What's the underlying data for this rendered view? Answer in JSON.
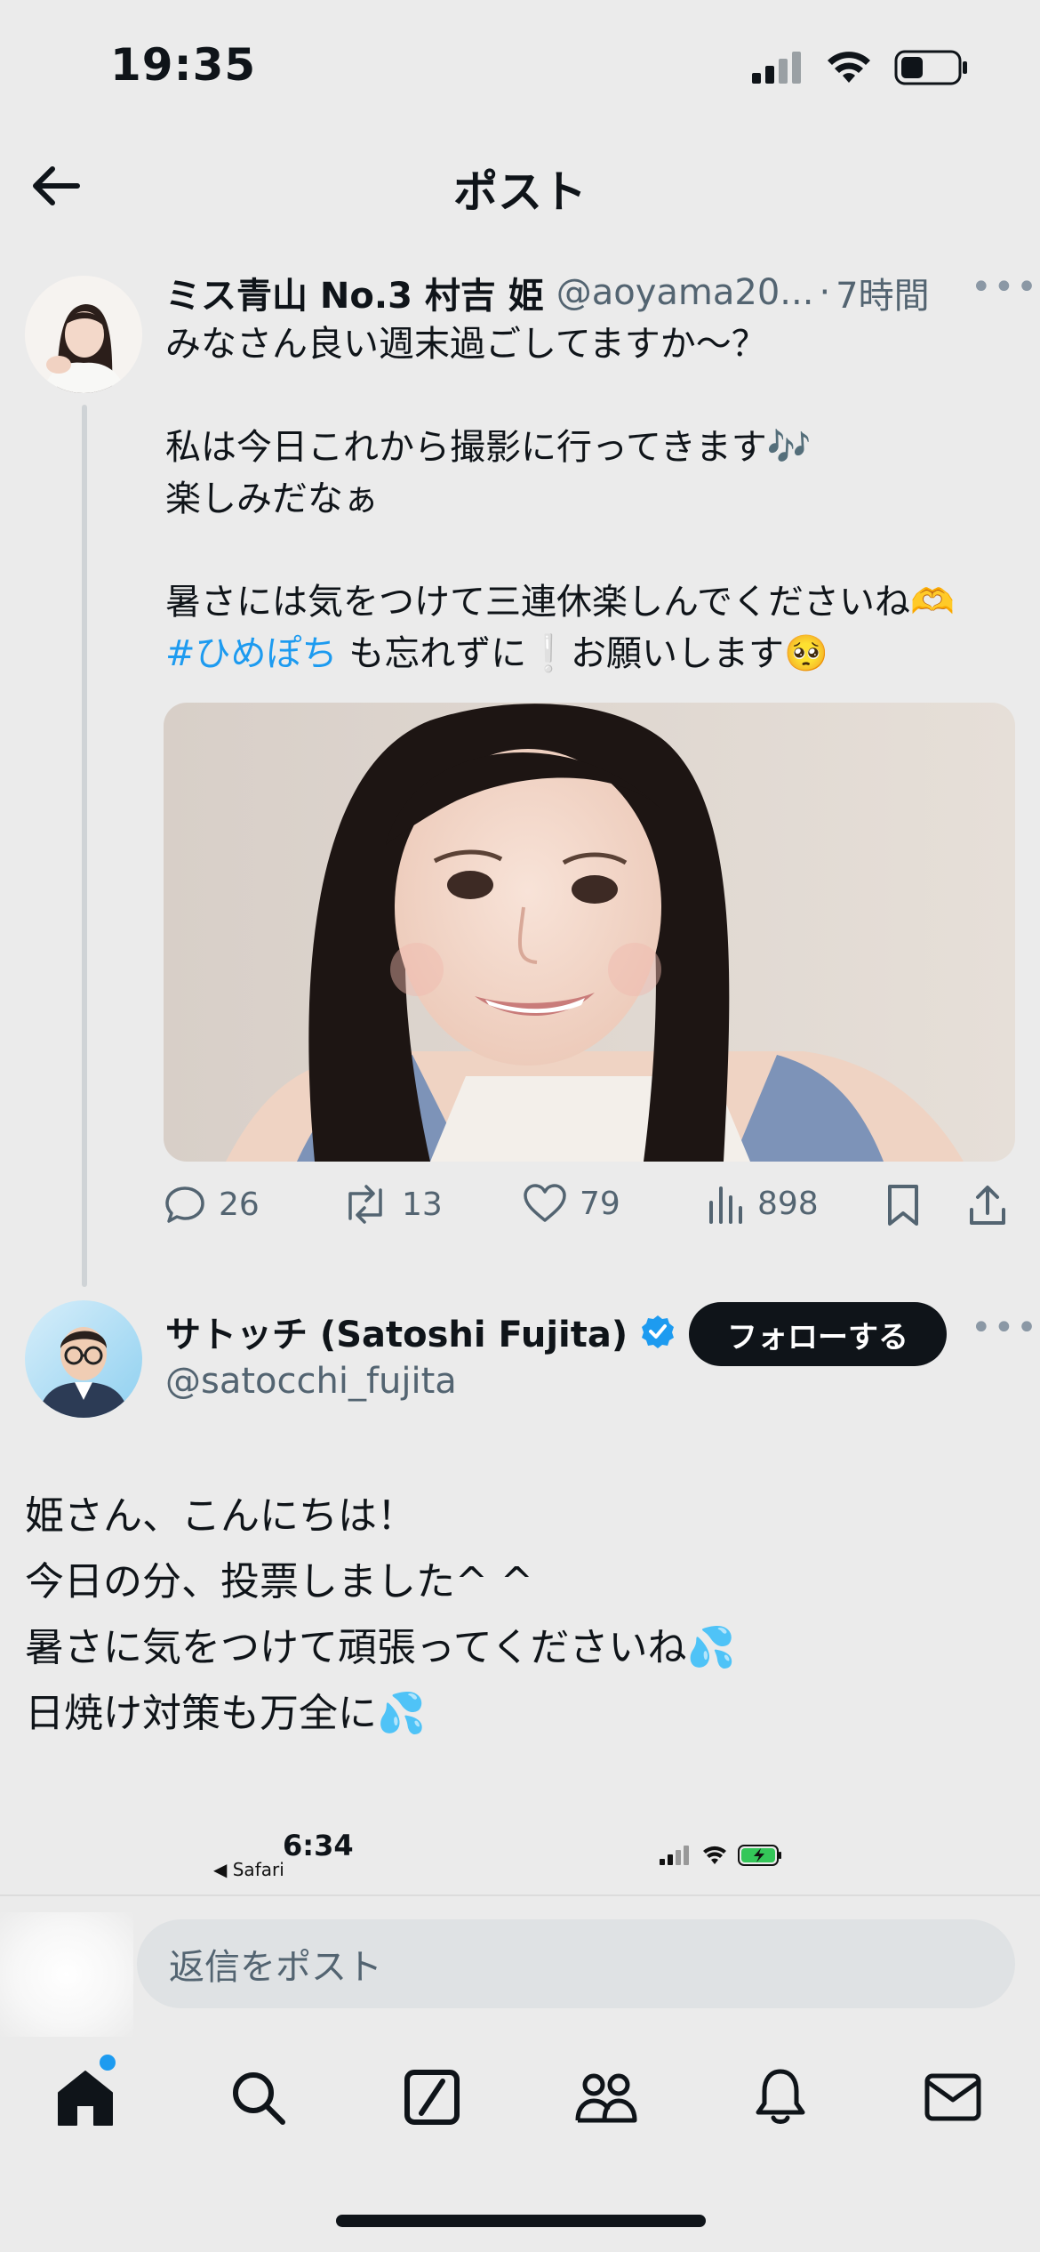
{
  "status_bar": {
    "time": "19:35",
    "battery_level": 0.35
  },
  "header": {
    "title": "ポスト"
  },
  "tweet": {
    "author_name": "ミス青山 No.3 村吉 姫",
    "handle": "@aoyama20...",
    "time_sep": "·",
    "time_ago": "7時間",
    "lines": [
      "みなさん良い週末過ごしてますか〜？",
      "",
      "私は今日これから撮影に行ってきます🎶",
      "楽しみだなぁ",
      "",
      "暑さには気をつけて三連休楽しんでくださいね🫶"
    ],
    "hashtag": "#ひめぽち",
    "hashtag_rest": " も忘れずに❕お願いします🥺",
    "replies": "26",
    "reposts": "13",
    "likes": "79",
    "views": "898"
  },
  "reply": {
    "author_name": "サトッチ (Satoshi Fujita)",
    "handle": "@satocchi_fujita",
    "follow_label": "フォローする",
    "lines": [
      "姫さん、こんにちは！",
      "今日の分、投票しました^ ^",
      "暑さに気をつけて頑張ってくださいね💦",
      "日焼け対策も万全に💦"
    ]
  },
  "embedded_status": {
    "time": "6:34",
    "back_label": "◀ Safari"
  },
  "composer": {
    "placeholder": "返信をポスト"
  },
  "tabs": [
    "home-icon",
    "search-icon",
    "grok-icon",
    "communities-icon",
    "notifications-icon",
    "messages-icon"
  ],
  "colors": {
    "accent": "#1d9bf0",
    "text": "#0f1419",
    "muted": "#536471",
    "background": "#ebebeb"
  }
}
